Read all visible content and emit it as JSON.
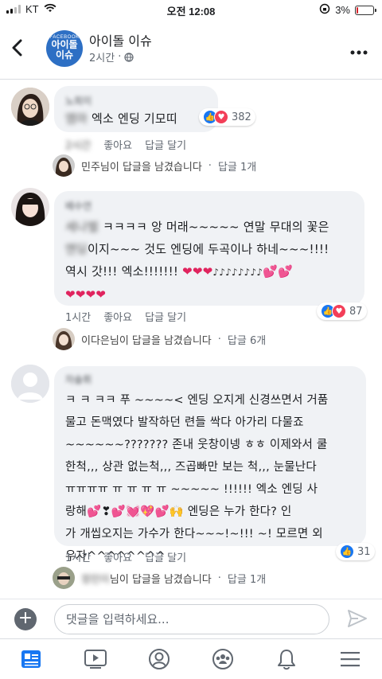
{
  "status_bar": {
    "carrier": "KT",
    "time": "오전 12:08",
    "battery": "3%",
    "battery_level": 0.03,
    "battery_color": "#d8232a"
  },
  "header": {
    "back_icon": "chevron-left-icon",
    "page_icon": {
      "small": "FACEBOOK",
      "line1": "아이돌",
      "line2": "이슈"
    },
    "title": "아이돌 이슈",
    "time": "2시간",
    "more_icon": "more-dots-icon"
  },
  "comments": [
    {
      "author": "노희미",
      "text_blurred": "엠마",
      "text": " 엑소 엔딩 기모띠",
      "time": "2시간",
      "like_label": "좋아요",
      "reply_label": "답글 달기",
      "reactions": {
        "icons": [
          "like",
          "love"
        ],
        "count": "382"
      },
      "replies": {
        "who": "민주님이 답글을 남겼습니다",
        "sep": "·",
        "count": "답글 1개"
      }
    },
    {
      "author": "배수연",
      "text_blurred": "세나벌",
      "line1": " ㅋㅋㅋㅋ 앙 머래~~~~~ 연말 무대의 꽃은",
      "line2_blurred": "엔딩",
      "line2": "이지~~~ 것도 엔딩에 두곡이나 하네~~~!!!!",
      "line3": "역시 갓!!! 엑소!!!!!!! ",
      "line3_hearts": "❤❤❤",
      "line3_notes": "♪♪♪♪♪♪♪♪",
      "line3_tail": "💕💕",
      "line4": "❤❤❤❤",
      "time": "1시간",
      "like_label": "좋아요",
      "reply_label": "답글 달기",
      "reactions": {
        "icons": [
          "like",
          "love"
        ],
        "count": "87"
      },
      "replies": {
        "who": "이다은님이 답글을 남겼습니다",
        "sep": "·",
        "count": "답글 6개"
      }
    },
    {
      "author": "차솔휘",
      "lines": [
        "ㅋ ㅋ ㅋㅋ 푸 ~~~~< 엔딩 오지게 신경쓰면서 거품",
        "물고 돈맥였다 발작하던 련들 싹다 아가리 다물죠",
        "~~~~~~??????? 존내 웃창이넹 ㅎㅎ 이제와서 쿨",
        "한척,,, 상관 없는척,,, 즈곱빠만 보는 척,,, 눈물난다",
        "ㅠㅠㅠㅠ ㅠ ㅠ ㅠ ㅠ ~~~~~ !!!!!! 엑소 엔딩 사",
        "랑해💕❣💕💓💖💕🙌 엔딩은 누가 한다? 인",
        "가 개씹오지는 가수가 한다~~~!~!!! ~! 모르면 외",
        "우자^^^^^^^^"
      ],
      "time": "1시간",
      "like_label": "좋아요",
      "reply_label": "답글 달기",
      "reactions": {
        "icons": [
          "like"
        ],
        "count": "31"
      },
      "replies": {
        "who_blurred": "정민이",
        "who": "님이 답글을 남겼습니다",
        "sep": "·",
        "count": "답글 1개"
      }
    }
  ],
  "composer": {
    "placeholder": "댓글을 입력하세요...",
    "add_icon": "plus-icon",
    "send_icon": "send-icon"
  },
  "tabs": [
    "news-feed-icon",
    "watch-icon",
    "profile-icon",
    "groups-icon",
    "notifications-icon",
    "menu-icon"
  ],
  "colors": {
    "accent": "#1877f2",
    "love": "#f33e58",
    "active_tab": "#1877f2"
  }
}
